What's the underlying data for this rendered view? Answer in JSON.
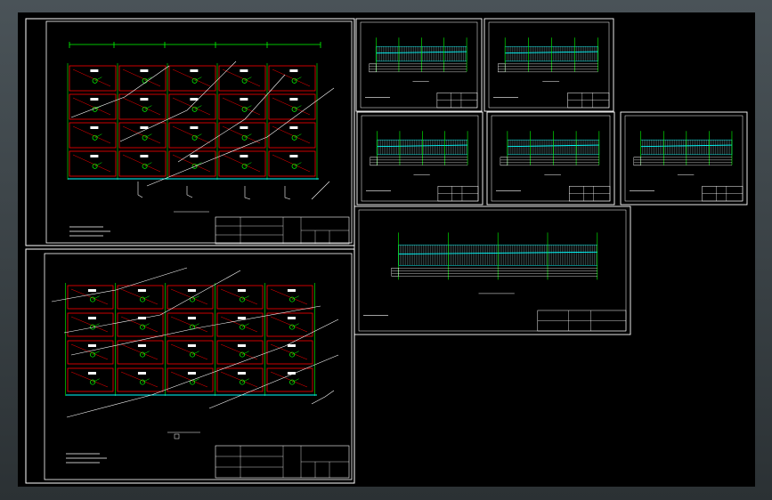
{
  "app": {
    "canvas_bg": "#000000",
    "frame_color": "#ffffff",
    "grid_color": "#00ff00",
    "room_color": "#ff0000",
    "pipe_color": "#00ffff"
  },
  "sheet1": {
    "top_dimension": "",
    "plan_title": "",
    "notes_heading": "",
    "notes": [],
    "title_block": []
  },
  "sheet2": {
    "plan_title": "",
    "notes_heading": "",
    "notes": [],
    "title_block": []
  },
  "profiles": [
    {
      "id": "profile-1"
    },
    {
      "id": "profile-2"
    },
    {
      "id": "profile-3"
    },
    {
      "id": "profile-4"
    },
    {
      "id": "profile-5"
    },
    {
      "id": "profile-6"
    }
  ]
}
